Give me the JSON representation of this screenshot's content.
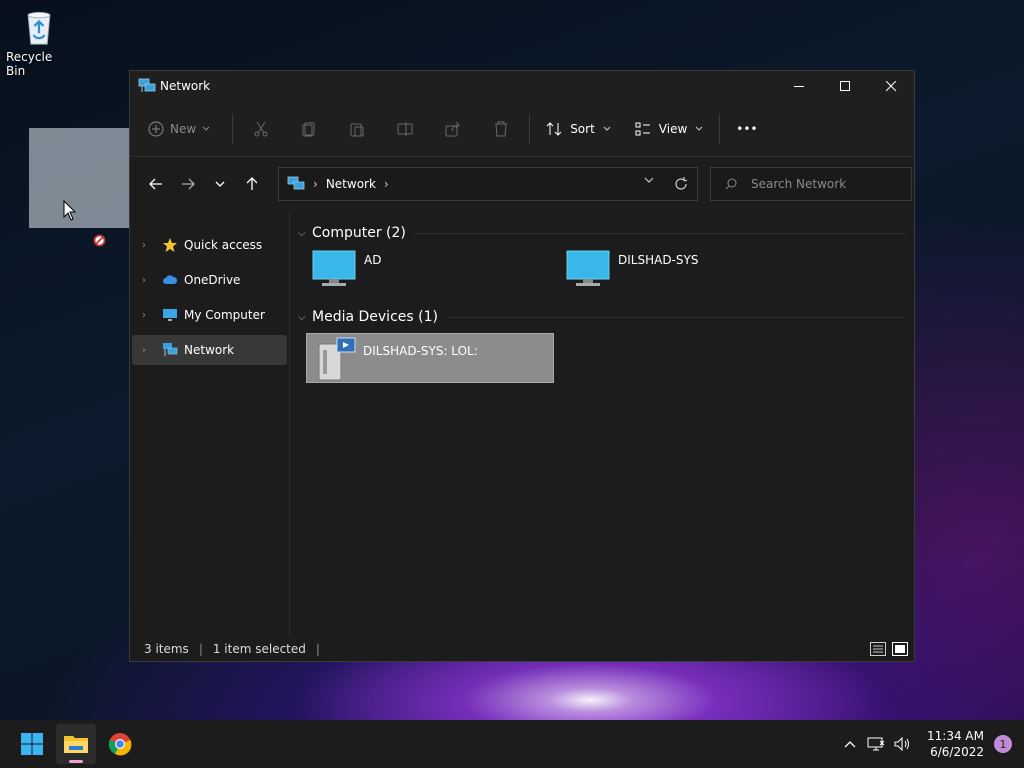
{
  "desktop": {
    "recycle_bin_label": "Recycle Bin"
  },
  "window": {
    "title": "Network",
    "controls": {
      "minimize": "minimize",
      "maximize": "maximize",
      "close": "close"
    }
  },
  "commandbar": {
    "new_label": "New",
    "sort_label": "Sort",
    "view_label": "View",
    "more_label": "•••"
  },
  "address": {
    "path": "Network",
    "search_placeholder": "Search Network"
  },
  "navpane": {
    "items": [
      {
        "label": "Quick access",
        "icon": "star-icon"
      },
      {
        "label": "OneDrive",
        "icon": "cloud-icon"
      },
      {
        "label": "My Computer",
        "icon": "monitor-icon"
      },
      {
        "label": "Network",
        "icon": "network-icon",
        "selected": true
      }
    ]
  },
  "content": {
    "groups": [
      {
        "header": "Computer (2)",
        "items": [
          {
            "label": "AD"
          },
          {
            "label": "DILSHAD-SYS"
          }
        ]
      },
      {
        "header": "Media Devices (1)",
        "items": [
          {
            "label": "DILSHAD-SYS: LOL:",
            "selected": true
          }
        ]
      }
    ]
  },
  "statusbar": {
    "items_count": "3 items",
    "selected_count": "1 item selected"
  },
  "taskbar": {
    "time": "11:34 AM",
    "date": "6/6/2022",
    "notification_count": "1"
  },
  "colors": {
    "accent": "#4cc2ff",
    "window_bg": "#1c1c1c",
    "selection_bg": "#8c8c8c"
  }
}
